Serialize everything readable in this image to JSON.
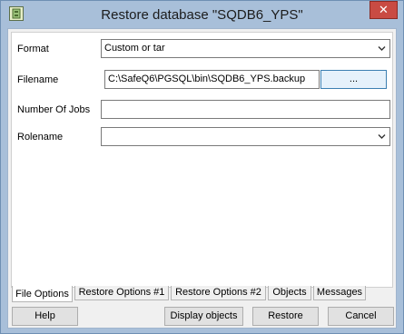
{
  "window": {
    "title": "Restore database \"SQDB6_YPS\"",
    "close_glyph": "✕"
  },
  "form": {
    "format": {
      "label": "Format",
      "value": "Custom or tar"
    },
    "filename": {
      "label": "Filename",
      "value": "C:\\SafeQ6\\PGSQL\\bin\\SQDB6_YPS.backup",
      "browse_label": "..."
    },
    "jobs": {
      "label": "Number Of Jobs",
      "value": ""
    },
    "rolename": {
      "label": "Rolename",
      "value": ""
    }
  },
  "tabs": [
    "File Options",
    "Restore Options #1",
    "Restore Options #2",
    "Objects",
    "Messages"
  ],
  "buttons": {
    "help": "Help",
    "display_objects": "Display objects",
    "restore": "Restore",
    "cancel": "Cancel"
  },
  "icons": {
    "app": "database-restore-icon",
    "dropdown": "chevron-down-icon",
    "close": "close-icon"
  }
}
